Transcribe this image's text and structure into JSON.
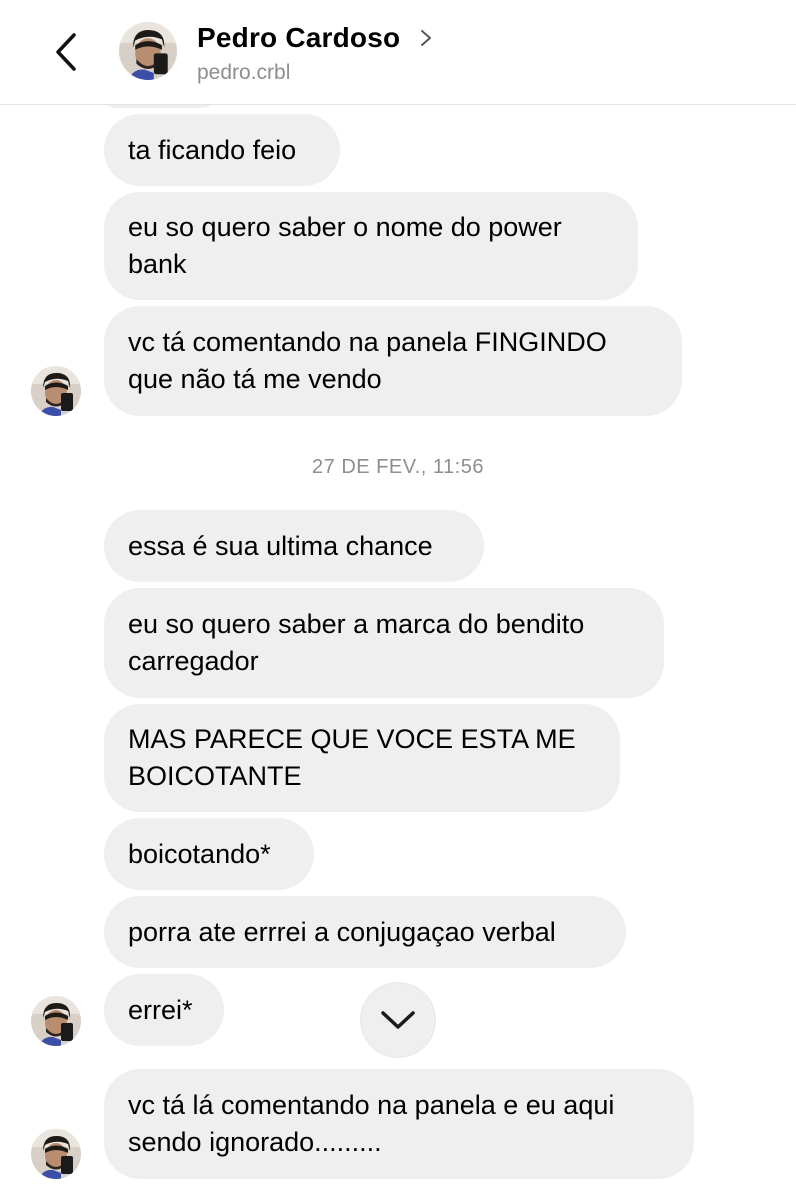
{
  "header": {
    "name": "Pedro Cardoso",
    "username": "pedro.crbl",
    "back_icon": "chevron-left-icon",
    "profile_icon": "chevron-right-icon"
  },
  "messages": [
    {
      "text": "ta ficando feio"
    },
    {
      "text": "eu so quero saber o nome do power\nbank"
    },
    {
      "text": "vc tá comentando na panela FINGINDO\nque não tá me vendo"
    },
    {
      "text": "essa é sua ultima chance"
    },
    {
      "text": "eu so quero saber a marca do bendito\ncarregador"
    },
    {
      "text": "MAS PARECE QUE VOCE ESTA ME\nBOICOTANTE"
    },
    {
      "text": "boicotando*"
    },
    {
      "text": "porra ate errrei a conjugaçao verbal"
    },
    {
      "text": "errei*"
    },
    {
      "text": "vc tá lá comentando na panela e eu aqui\nsendo ignorado........."
    }
  ],
  "timestamp": "27 DE FEV., 11:56",
  "scroll_button_icon": "chevron-down-icon",
  "colors": {
    "bubble": "#efefef",
    "secondary_text": "#8e8e8e",
    "background": "#ffffff"
  }
}
